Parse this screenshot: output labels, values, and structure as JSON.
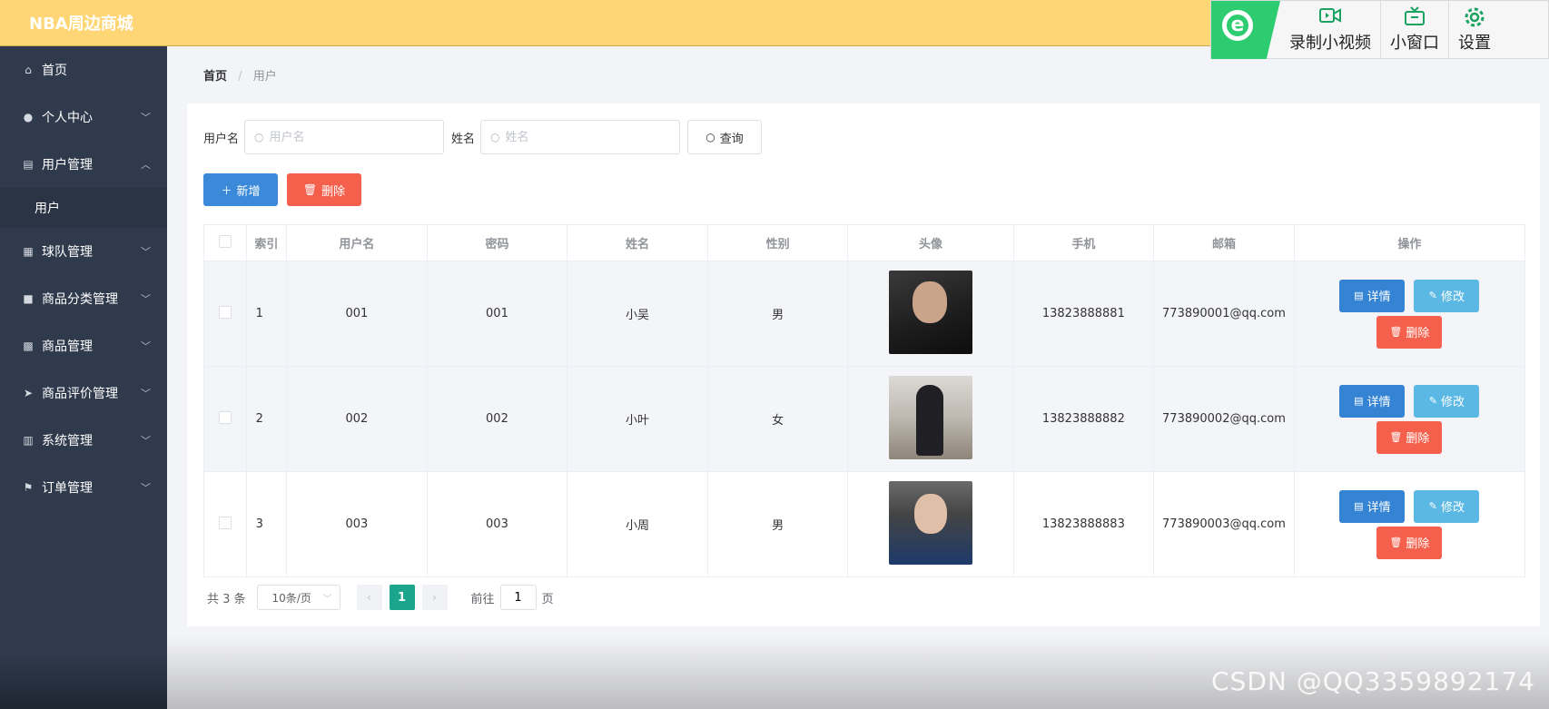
{
  "app": {
    "brand": "NBA周边商城"
  },
  "recorder": {
    "buttons": [
      {
        "icon": "video-camera-icon",
        "label": "录制小视频"
      },
      {
        "icon": "tv-icon",
        "label": "小窗口"
      },
      {
        "icon": "gear-icon",
        "label": "设置"
      }
    ]
  },
  "sidebar": {
    "items": [
      {
        "icon": "home-icon",
        "label": "首页"
      },
      {
        "icon": "user-icon",
        "label": "个人中心"
      },
      {
        "icon": "clipboard-icon",
        "label": "用户管理",
        "sub": "用户"
      },
      {
        "icon": "grid-icon",
        "label": "球队管理"
      },
      {
        "icon": "briefcase-icon",
        "label": "商品分类管理"
      },
      {
        "icon": "apps-icon",
        "label": "商品管理"
      },
      {
        "icon": "send-icon",
        "label": "商品评价管理"
      },
      {
        "icon": "chart-icon",
        "label": "系统管理"
      },
      {
        "icon": "flag-icon",
        "label": "订单管理"
      }
    ]
  },
  "breadcrumb": {
    "home": "首页",
    "sep": "/",
    "current": "用户"
  },
  "search": {
    "username_label": "用户名",
    "username_placeholder": "用户名",
    "name_label": "姓名",
    "name_placeholder": "姓名",
    "query_label": "查询"
  },
  "actions": {
    "add_label": "新增",
    "delete_label": "删除"
  },
  "table": {
    "headers": [
      "索引",
      "用户名",
      "密码",
      "姓名",
      "性别",
      "头像",
      "手机",
      "邮箱",
      "操作"
    ],
    "rows": [
      {
        "index": "1",
        "username": "001",
        "password": "001",
        "name": "小吴",
        "gender": "男",
        "phone": "13823888881",
        "email": "773890001@qq.com"
      },
      {
        "index": "2",
        "username": "002",
        "password": "002",
        "name": "小叶",
        "gender": "女",
        "phone": "13823888882",
        "email": "773890002@qq.com"
      },
      {
        "index": "3",
        "username": "003",
        "password": "003",
        "name": "小周",
        "gender": "男",
        "phone": "13823888883",
        "email": "773890003@qq.com"
      }
    ],
    "ops": {
      "detail": "详情",
      "edit": "修改",
      "delete": "删除"
    }
  },
  "pagination": {
    "total": "共 3 条",
    "page_size": "10条/页",
    "current_page": "1",
    "goto_prefix": "前往",
    "goto_value": "1",
    "goto_suffix": "页"
  },
  "watermark": "CSDN @QQ3359892174"
}
